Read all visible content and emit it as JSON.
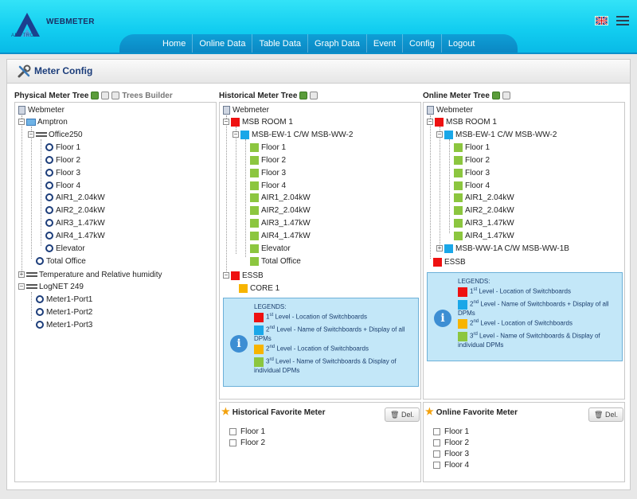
{
  "header": {
    "brand": "WEBMETER",
    "brand_sub": "AMPTRON",
    "nav": [
      "Home",
      "Online Data",
      "Table Data",
      "Graph Data",
      "Event",
      "Config",
      "Logout"
    ]
  },
  "page": {
    "title": "Meter Config"
  },
  "physical": {
    "title": "Physical Meter Tree",
    "builder": "Trees Builder",
    "root": "Webmeter",
    "amptron": "Amptron",
    "office": "Office250",
    "meters": [
      "Floor 1",
      "Floor 2",
      "Floor 3",
      "Floor 4",
      "AIR1_2.04kW",
      "AIR2_2.04kW",
      "AIR3_1.47kW",
      "AIR4_1.47kW",
      "Elevator"
    ],
    "total_office": "Total Office",
    "temp": "Temperature and Relative humidity",
    "lognet": "LogNET 249",
    "ports": [
      "Meter1-Port1",
      "Meter1-Port2",
      "Meter1-Port3"
    ]
  },
  "historical": {
    "title": "Historical Meter Tree",
    "root": "Webmeter",
    "room": "MSB ROOM 1",
    "switch": "MSB-EW-1 C/W MSB-WW-2",
    "meters": [
      "Floor 1",
      "Floor 2",
      "Floor 3",
      "Floor 4",
      "AIR1_2.04kW",
      "AIR2_2.04kW",
      "AIR3_1.47kW",
      "AIR4_1.47kW",
      "Elevator",
      "Total Office"
    ],
    "essb": "ESSB",
    "core": "CORE 1"
  },
  "online": {
    "title": "Online Meter Tree",
    "root": "Webmeter",
    "room": "MSB ROOM 1",
    "switch": "MSB-EW-1 C/W MSB-WW-2",
    "meters": [
      "Floor 1",
      "Floor 2",
      "Floor 3",
      "Floor 4",
      "AIR1_2.04kW",
      "AIR2_2.04kW",
      "AIR3_1.47kW",
      "AIR4_1.47kW"
    ],
    "switch2": "MSB-WW-1A C/W MSB-WW-1B",
    "essb": "ESSB"
  },
  "legend": {
    "title": "LEGENDS:",
    "l1": "Level - Location of Switchboards",
    "l2": "Level - Name of Switchboards + Display of all DPMs",
    "l2b": "Level - Location of Switchboards",
    "l3": "Level - Name of Switchboards & Display of individual DPMs",
    "s1": "st",
    "s2": "nd",
    "s3": "rd",
    "n1": "1",
    "n2": "2",
    "n3": "3"
  },
  "historical_fav": {
    "title": "Historical Favorite Meter",
    "del": "Del.",
    "items": [
      "Floor 1",
      "Floor 2"
    ]
  },
  "online_fav": {
    "title": "Online Favorite Meter",
    "del": "Del.",
    "items": [
      "Floor 1",
      "Floor 2",
      "Floor 3",
      "Floor 4"
    ]
  },
  "colors": {
    "level1": "#ee1111",
    "level2": "#1aa7e8",
    "level2b": "#f7b400",
    "level3": "#8cc63f"
  }
}
